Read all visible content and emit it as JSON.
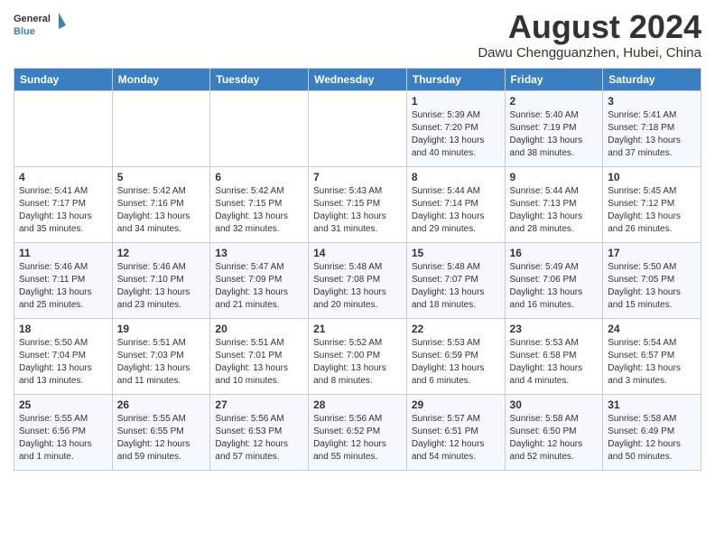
{
  "header": {
    "logo_line1": "General",
    "logo_line2": "Blue",
    "month_title": "August 2024",
    "subtitle": "Dawu Chengguanzhen, Hubei, China"
  },
  "days_of_week": [
    "Sunday",
    "Monday",
    "Tuesday",
    "Wednesday",
    "Thursday",
    "Friday",
    "Saturday"
  ],
  "weeks": [
    [
      {
        "day": "",
        "content": ""
      },
      {
        "day": "",
        "content": ""
      },
      {
        "day": "",
        "content": ""
      },
      {
        "day": "",
        "content": ""
      },
      {
        "day": "1",
        "content": "Sunrise: 5:39 AM\nSunset: 7:20 PM\nDaylight: 13 hours\nand 40 minutes."
      },
      {
        "day": "2",
        "content": "Sunrise: 5:40 AM\nSunset: 7:19 PM\nDaylight: 13 hours\nand 38 minutes."
      },
      {
        "day": "3",
        "content": "Sunrise: 5:41 AM\nSunset: 7:18 PM\nDaylight: 13 hours\nand 37 minutes."
      }
    ],
    [
      {
        "day": "4",
        "content": "Sunrise: 5:41 AM\nSunset: 7:17 PM\nDaylight: 13 hours\nand 35 minutes."
      },
      {
        "day": "5",
        "content": "Sunrise: 5:42 AM\nSunset: 7:16 PM\nDaylight: 13 hours\nand 34 minutes."
      },
      {
        "day": "6",
        "content": "Sunrise: 5:42 AM\nSunset: 7:15 PM\nDaylight: 13 hours\nand 32 minutes."
      },
      {
        "day": "7",
        "content": "Sunrise: 5:43 AM\nSunset: 7:15 PM\nDaylight: 13 hours\nand 31 minutes."
      },
      {
        "day": "8",
        "content": "Sunrise: 5:44 AM\nSunset: 7:14 PM\nDaylight: 13 hours\nand 29 minutes."
      },
      {
        "day": "9",
        "content": "Sunrise: 5:44 AM\nSunset: 7:13 PM\nDaylight: 13 hours\nand 28 minutes."
      },
      {
        "day": "10",
        "content": "Sunrise: 5:45 AM\nSunset: 7:12 PM\nDaylight: 13 hours\nand 26 minutes."
      }
    ],
    [
      {
        "day": "11",
        "content": "Sunrise: 5:46 AM\nSunset: 7:11 PM\nDaylight: 13 hours\nand 25 minutes."
      },
      {
        "day": "12",
        "content": "Sunrise: 5:46 AM\nSunset: 7:10 PM\nDaylight: 13 hours\nand 23 minutes."
      },
      {
        "day": "13",
        "content": "Sunrise: 5:47 AM\nSunset: 7:09 PM\nDaylight: 13 hours\nand 21 minutes."
      },
      {
        "day": "14",
        "content": "Sunrise: 5:48 AM\nSunset: 7:08 PM\nDaylight: 13 hours\nand 20 minutes."
      },
      {
        "day": "15",
        "content": "Sunrise: 5:48 AM\nSunset: 7:07 PM\nDaylight: 13 hours\nand 18 minutes."
      },
      {
        "day": "16",
        "content": "Sunrise: 5:49 AM\nSunset: 7:06 PM\nDaylight: 13 hours\nand 16 minutes."
      },
      {
        "day": "17",
        "content": "Sunrise: 5:50 AM\nSunset: 7:05 PM\nDaylight: 13 hours\nand 15 minutes."
      }
    ],
    [
      {
        "day": "18",
        "content": "Sunrise: 5:50 AM\nSunset: 7:04 PM\nDaylight: 13 hours\nand 13 minutes."
      },
      {
        "day": "19",
        "content": "Sunrise: 5:51 AM\nSunset: 7:03 PM\nDaylight: 13 hours\nand 11 minutes."
      },
      {
        "day": "20",
        "content": "Sunrise: 5:51 AM\nSunset: 7:01 PM\nDaylight: 13 hours\nand 10 minutes."
      },
      {
        "day": "21",
        "content": "Sunrise: 5:52 AM\nSunset: 7:00 PM\nDaylight: 13 hours\nand 8 minutes."
      },
      {
        "day": "22",
        "content": "Sunrise: 5:53 AM\nSunset: 6:59 PM\nDaylight: 13 hours\nand 6 minutes."
      },
      {
        "day": "23",
        "content": "Sunrise: 5:53 AM\nSunset: 6:58 PM\nDaylight: 13 hours\nand 4 minutes."
      },
      {
        "day": "24",
        "content": "Sunrise: 5:54 AM\nSunset: 6:57 PM\nDaylight: 13 hours\nand 3 minutes."
      }
    ],
    [
      {
        "day": "25",
        "content": "Sunrise: 5:55 AM\nSunset: 6:56 PM\nDaylight: 13 hours\nand 1 minute."
      },
      {
        "day": "26",
        "content": "Sunrise: 5:55 AM\nSunset: 6:55 PM\nDaylight: 12 hours\nand 59 minutes."
      },
      {
        "day": "27",
        "content": "Sunrise: 5:56 AM\nSunset: 6:53 PM\nDaylight: 12 hours\nand 57 minutes."
      },
      {
        "day": "28",
        "content": "Sunrise: 5:56 AM\nSunset: 6:52 PM\nDaylight: 12 hours\nand 55 minutes."
      },
      {
        "day": "29",
        "content": "Sunrise: 5:57 AM\nSunset: 6:51 PM\nDaylight: 12 hours\nand 54 minutes."
      },
      {
        "day": "30",
        "content": "Sunrise: 5:58 AM\nSunset: 6:50 PM\nDaylight: 12 hours\nand 52 minutes."
      },
      {
        "day": "31",
        "content": "Sunrise: 5:58 AM\nSunset: 6:49 PM\nDaylight: 12 hours\nand 50 minutes."
      }
    ]
  ]
}
